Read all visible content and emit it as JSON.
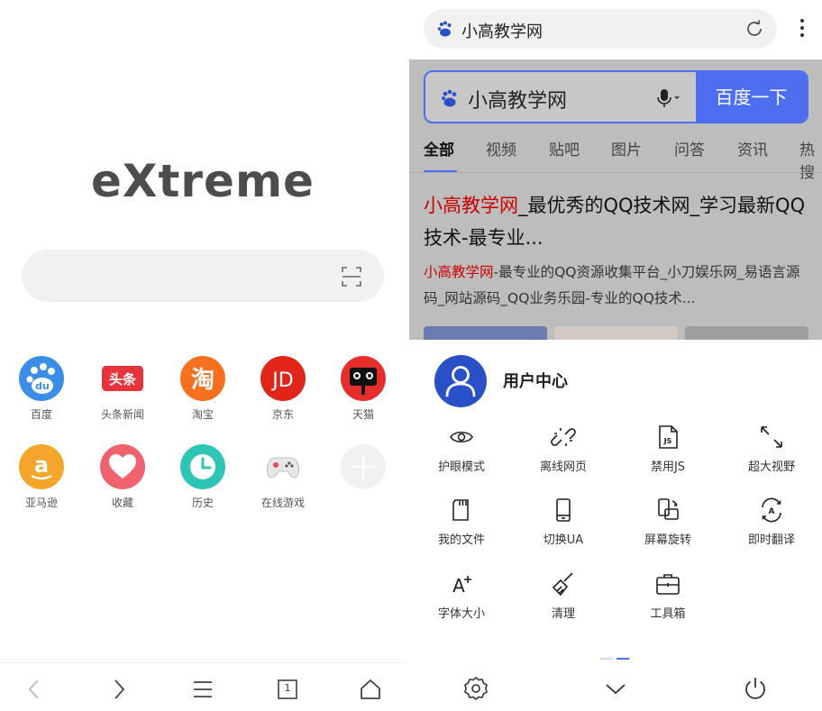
{
  "left": {
    "logo": "eXtreme",
    "search": {
      "value": "",
      "placeholder": ""
    },
    "quick_links": [
      {
        "label": "百度",
        "icon": "baidu-icon"
      },
      {
        "label": "头条新闻",
        "icon": "toutiao-icon",
        "glyph": "头条"
      },
      {
        "label": "淘宝",
        "icon": "taobao-icon",
        "glyph": "淘"
      },
      {
        "label": "京东",
        "icon": "jd-icon",
        "glyph": "JD"
      },
      {
        "label": "天猫",
        "icon": "tmall-icon"
      },
      {
        "label": "亚马逊",
        "icon": "amazon-icon",
        "glyph": "a"
      },
      {
        "label": "收藏",
        "icon": "heart-icon"
      },
      {
        "label": "历史",
        "icon": "clock-icon"
      },
      {
        "label": "在线游戏",
        "icon": "gamepad-icon"
      },
      {
        "label": "",
        "icon": "add-icon"
      }
    ],
    "nav": {
      "tab_count": "1"
    }
  },
  "right": {
    "url_bar": {
      "title": "小高教学网"
    },
    "web": {
      "query": "小高教学网",
      "search_button": "百度一下",
      "tabs": [
        "全部",
        "视频",
        "贴吧",
        "图片",
        "问答",
        "资讯",
        "热搜"
      ],
      "result_title_hl": "小高教学网",
      "result_title_rest": "_最优秀的QQ技术网_学习最新QQ技术-最专业...",
      "result_snippet_hl": "小高教学网",
      "result_snippet_rest": "-最专业的QQ资源收集平台_小刀娱乐网_易语言源码_网站源码_QQ业务乐园-专业的QQ技术..."
    },
    "menu": {
      "user_center": "用户中心",
      "items": [
        {
          "label": "护眼模式",
          "icon": "eye-icon"
        },
        {
          "label": "离线网页",
          "icon": "link-broken-icon"
        },
        {
          "label": "禁用JS",
          "icon": "js-file-icon"
        },
        {
          "label": "超大视野",
          "icon": "expand-icon"
        },
        {
          "label": "我的文件",
          "icon": "sd-card-icon"
        },
        {
          "label": "切换UA",
          "icon": "phone-icon"
        },
        {
          "label": "屏幕旋转",
          "icon": "rotate-screen-icon"
        },
        {
          "label": "即时翻译",
          "icon": "translate-icon"
        },
        {
          "label": "字体大小",
          "icon": "font-size-icon"
        },
        {
          "label": "清理",
          "icon": "broom-icon"
        },
        {
          "label": "工具箱",
          "icon": "toolbox-icon"
        }
      ]
    }
  },
  "colors": {
    "accent": "#4e6ef2",
    "baidu_blue": "#2a50c8",
    "highlight_red": "#cc0000"
  }
}
